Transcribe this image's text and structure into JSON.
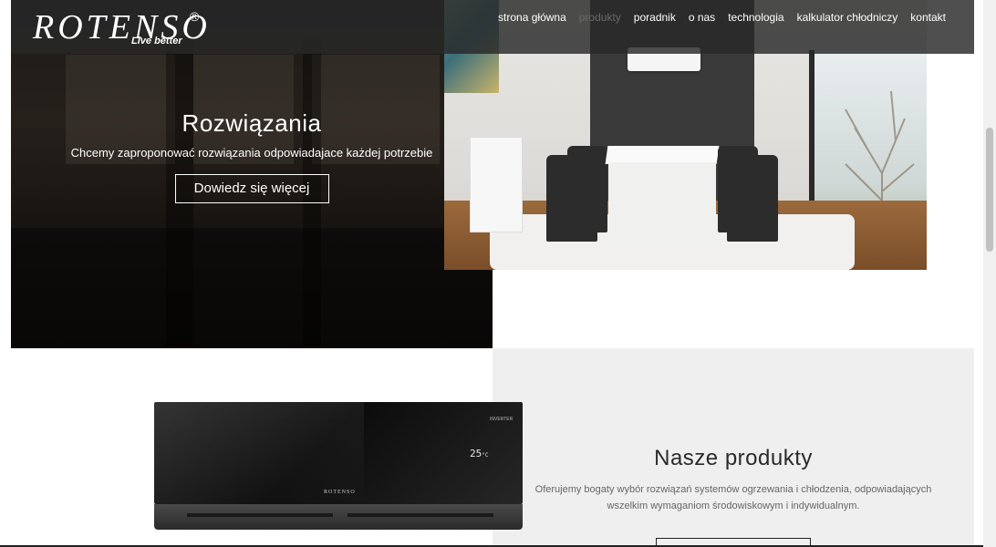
{
  "header": {
    "logo_text": "ROTENSO",
    "logo_registered": "®",
    "logo_tagline": "Live better",
    "nav": [
      {
        "label": "strona główna",
        "active": false
      },
      {
        "label": "produkty",
        "active": true
      },
      {
        "label": "poradnik",
        "active": false
      },
      {
        "label": "o nas",
        "active": false
      },
      {
        "label": "technologia",
        "active": false
      },
      {
        "label": "kalkulator chłodniczy",
        "active": false
      },
      {
        "label": "kontakt",
        "active": false
      }
    ]
  },
  "hero": {
    "title": "Rozwiązania",
    "subtitle": "Chcemy zaproponować rozwiązania odpowiadajace każdej potrzebie",
    "button_label": "Dowiedz się więcej"
  },
  "product_image": {
    "display_value": "25",
    "display_unit": "°C",
    "brand": "ROTENSO",
    "badge": "INVERTER"
  },
  "products": {
    "title": "Nasze produkty",
    "description": "Oferujemy bogaty wybór rozwiązań systemów ogrzewania i chłodzenia, odpowiadających wszelkim wymaganiom środowiskowym i indywidualnym."
  },
  "colors": {
    "header_bg": "#282828",
    "active_nav": "#6a6a6a",
    "section_bg": "#efefef"
  }
}
